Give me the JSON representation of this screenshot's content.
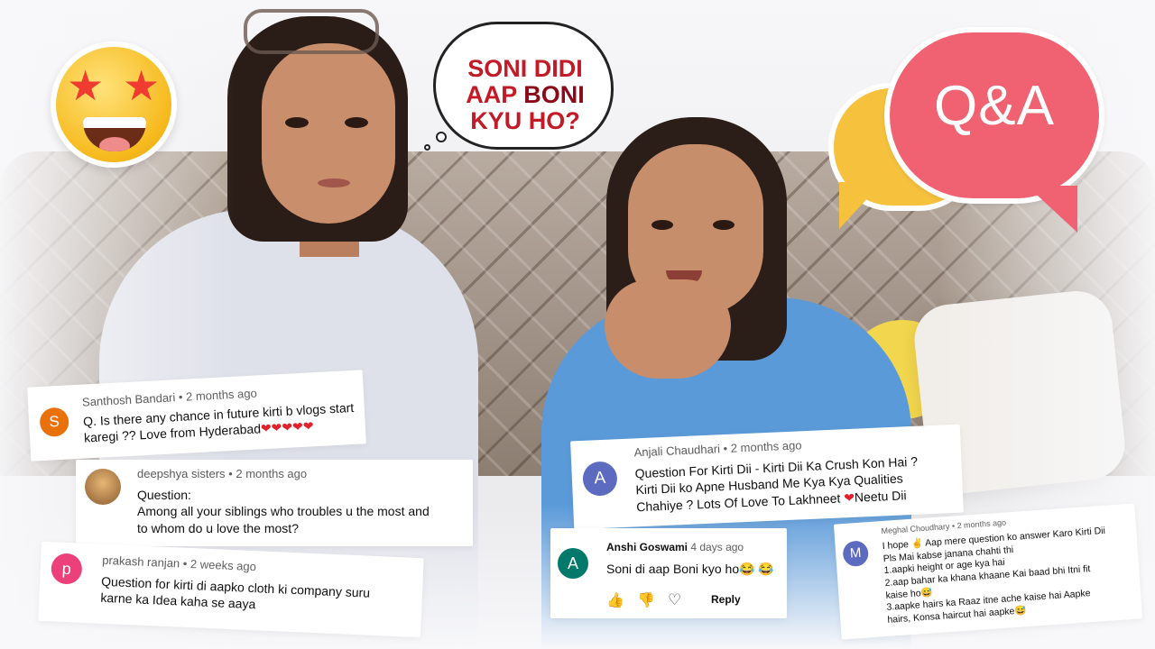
{
  "speech_bubble": {
    "line1": "SONI DIDI",
    "line2_a": "AAP ",
    "line2_b": "BONI",
    "line3": "KYU HO?"
  },
  "qa_badge": {
    "label": "Q&A"
  },
  "colors": {
    "pink": "#f06271",
    "yellow": "#f6c23e",
    "speech_red": "#c21a27"
  },
  "comments": [
    {
      "author": "Santhosh Bandari",
      "age": "• 2 months ago",
      "initial": "S",
      "avatar_color": "#e8710a",
      "text_line1": "Q. Is there any chance in future kirti b vlogs start",
      "text_line2": "karegi ?? Love from Hyderabad",
      "hearts": "❤❤❤❤❤"
    },
    {
      "author": "deepshya sisters",
      "age": "• 2 months ago",
      "avatar_color": "#c49a3c",
      "text_line1": "Question:",
      "text_line2": "Among all your siblings who troubles u the most and",
      "text_line3": "to whom do u love the most?"
    },
    {
      "author": "prakash ranjan",
      "age": "• 2 weeks ago",
      "initial": "p",
      "avatar_color": "#ec407a",
      "text_line1": "Question for kirti di aapko cloth ki company suru",
      "text_line2": "karne ka Idea kaha se aaya"
    },
    {
      "author": "Anjali Chaudhari",
      "age": "• 2 months ago",
      "initial": "A",
      "avatar_color": "#5c6bc0",
      "text_line1": "Question For Kirti Dii - Kirti Dii Ka Crush Kon Hai  ?",
      "text_line2": "Kirti Dii ko Apne Husband Me Kya Kya Qualities",
      "text_line3a": "Chahiye  ? Lots Of Love To Lakhneet ",
      "heart": "❤",
      "text_line3b": "Neetu Dii"
    },
    {
      "author": "Anshi Goswami",
      "age": "4 days ago",
      "initial": "A",
      "avatar_color": "#00796b",
      "text": "Soni di aap Boni kyo ho",
      "emoji": "😂 😂",
      "reply_label": "Reply"
    },
    {
      "author": "Meghal Choudhary",
      "age": "• 2 months ago",
      "initial": "M",
      "avatar_color": "#5c6bc0",
      "lines": [
        "I hope ✌ Aap mere question ko answer Karo Kirti Dii",
        "Pls Mai kabse janana chahti thi",
        "1.aapki height or age kya hai",
        "2.aap bahar ka khana khaane Kai baad bhi Itni fit",
        "kaise ho😅",
        "3.aapke hairs ka Raaz itne ache kaise hai Aapke",
        "hairs, Konsa haircut hai aapke😅"
      ]
    }
  ]
}
